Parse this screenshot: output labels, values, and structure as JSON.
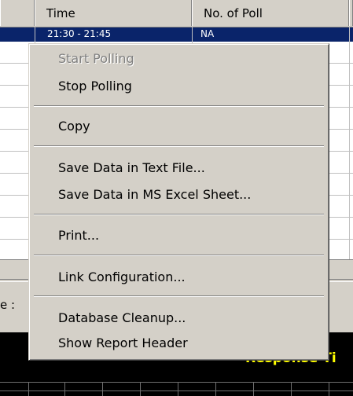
{
  "table": {
    "columns": [
      "Time",
      "No. of Poll"
    ],
    "selected_row": {
      "time": "21:30 - 21:45",
      "polls": "NA"
    }
  },
  "panel": {
    "label_fragment": "e :"
  },
  "chart": {
    "title_fragment": "Response Ti"
  },
  "context_menu": {
    "items": [
      {
        "label": "Start Polling",
        "enabled": false
      },
      {
        "label": "Stop Polling",
        "enabled": true
      },
      {
        "label": "Copy",
        "enabled": true
      },
      {
        "label": "Save Data in Text File...",
        "enabled": true
      },
      {
        "label": "Save Data in MS Excel Sheet...",
        "enabled": true
      },
      {
        "label": "Print...",
        "enabled": true
      },
      {
        "label": "Link Configuration...",
        "enabled": true
      },
      {
        "label": "Database Cleanup...",
        "enabled": true
      },
      {
        "label": "Show Report Header",
        "enabled": true
      }
    ]
  }
}
